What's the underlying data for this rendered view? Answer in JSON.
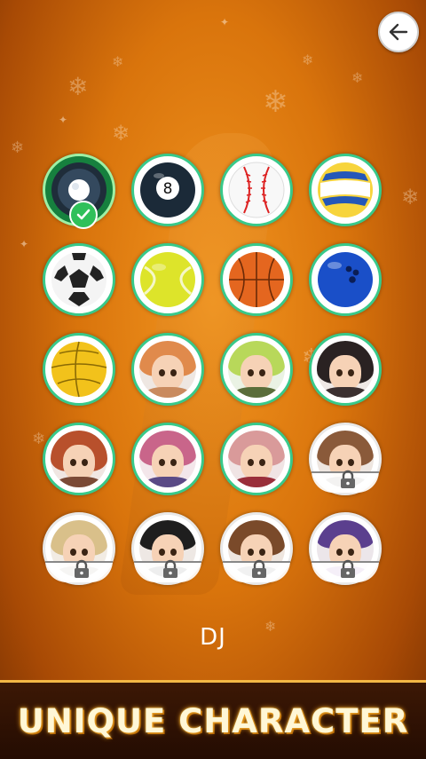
{
  "screen": {
    "back_icon": "arrow-left-icon",
    "selected_name": "DJ",
    "banner_text": "UNIQUE CHARACTER"
  },
  "characters": [
    {
      "kind": "ball",
      "icon": "dj-disc-icon",
      "state": "selected"
    },
    {
      "kind": "ball",
      "icon": "billiard-8-ball-icon",
      "state": "unlocked"
    },
    {
      "kind": "ball",
      "icon": "baseball-icon",
      "state": "unlocked"
    },
    {
      "kind": "ball",
      "icon": "volleyball-icon",
      "state": "unlocked"
    },
    {
      "kind": "ball",
      "icon": "soccer-ball-icon",
      "state": "unlocked"
    },
    {
      "kind": "ball",
      "icon": "tennis-ball-icon",
      "state": "unlocked"
    },
    {
      "kind": "ball",
      "icon": "basketball-icon",
      "state": "unlocked"
    },
    {
      "kind": "ball",
      "icon": "bowling-ball-icon",
      "state": "unlocked"
    },
    {
      "kind": "ball",
      "icon": "yellow-volleyball-icon",
      "state": "unlocked"
    },
    {
      "kind": "avatar",
      "icon": "avatar-orange-hair-icon",
      "state": "unlocked"
    },
    {
      "kind": "avatar",
      "icon": "avatar-green-hair-icon",
      "state": "unlocked"
    },
    {
      "kind": "avatar",
      "icon": "avatar-black-hair-icon",
      "state": "unlocked"
    },
    {
      "kind": "avatar",
      "icon": "avatar-red-hair-icon",
      "state": "unlocked"
    },
    {
      "kind": "avatar",
      "icon": "avatar-pink-hair-icon",
      "state": "unlocked"
    },
    {
      "kind": "avatar",
      "icon": "avatar-pink-spiky-hair-icon",
      "state": "unlocked"
    },
    {
      "kind": "avatar",
      "icon": "avatar-brown-hair-icon",
      "state": "locked"
    },
    {
      "kind": "avatar",
      "icon": "avatar-blonde-hair-icon",
      "state": "locked"
    },
    {
      "kind": "avatar",
      "icon": "avatar-black-cap-icon",
      "state": "locked"
    },
    {
      "kind": "avatar",
      "icon": "avatar-brown-bangs-icon",
      "state": "locked"
    },
    {
      "kind": "avatar",
      "icon": "avatar-purple-beanie-icon",
      "state": "locked"
    }
  ],
  "colors": {
    "background_accent": "#d9740c",
    "unlocked_ring": "#38c98a",
    "selected_bg": "#16803e",
    "banner_glow": "#f0a020"
  }
}
